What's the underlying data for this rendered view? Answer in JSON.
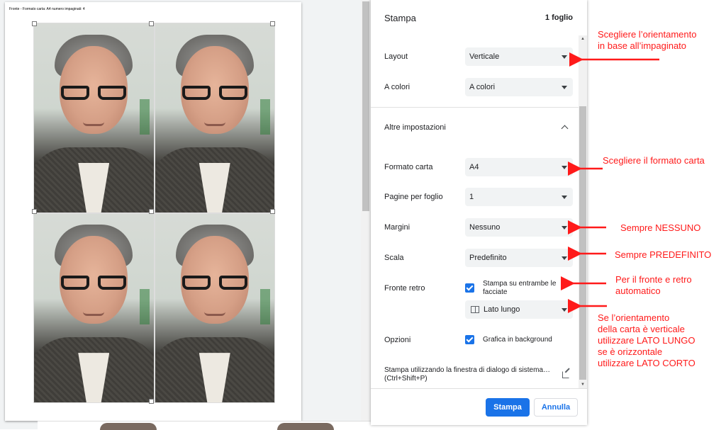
{
  "preview": {
    "header_text": "Fronte - Formato carta: A4 numero impaginati: 4"
  },
  "panel": {
    "title": "Stampa",
    "sheet_count": "1 foglio"
  },
  "settings": {
    "layout": {
      "label": "Layout",
      "value": "Verticale"
    },
    "color": {
      "label": "A colori",
      "value": "A colori"
    },
    "more_settings": {
      "label": "Altre impostazioni"
    },
    "paper_size": {
      "label": "Formato carta",
      "value": "A4"
    },
    "pages_per_sheet": {
      "label": "Pagine per foglio",
      "value": "1"
    },
    "margins": {
      "label": "Margini",
      "value": "Nessuno"
    },
    "scale": {
      "label": "Scala",
      "value": "Predefinito"
    },
    "duplex": {
      "label": "Fronte retro",
      "checkbox_line1": "Stampa su entrambe le",
      "checkbox_line2": "facciate",
      "checked": true,
      "flip_value": "Lato lungo"
    },
    "options": {
      "label": "Opzioni",
      "checkbox": "Grafica in background",
      "checked": true
    },
    "system_dialog": {
      "line1": "Stampa utilizzando la finestra di dialogo di sistema…",
      "line2": "(Ctrl+Shift+P)"
    }
  },
  "footer": {
    "print_label": "Stampa",
    "cancel_label": "Annulla"
  },
  "annotations": {
    "orientation": [
      "Scegliere l’orientamento",
      "in base all’impaginato"
    ],
    "paper_size": "Scegliere il formato carta",
    "margins": "Sempre NESSUNO",
    "scale": "Sempre PREDEFINITO",
    "duplex": [
      "Per il fronte e retro",
      "automatico"
    ],
    "flip": [
      "Se l’orientamento",
      "della carta è verticale",
      "utilizzare LATO LUNGO",
      "se è orizzontale",
      "utilizzare LATO CORTO"
    ]
  },
  "colors": {
    "accent": "#1a73e8",
    "annotation": "#ff1a1a"
  }
}
